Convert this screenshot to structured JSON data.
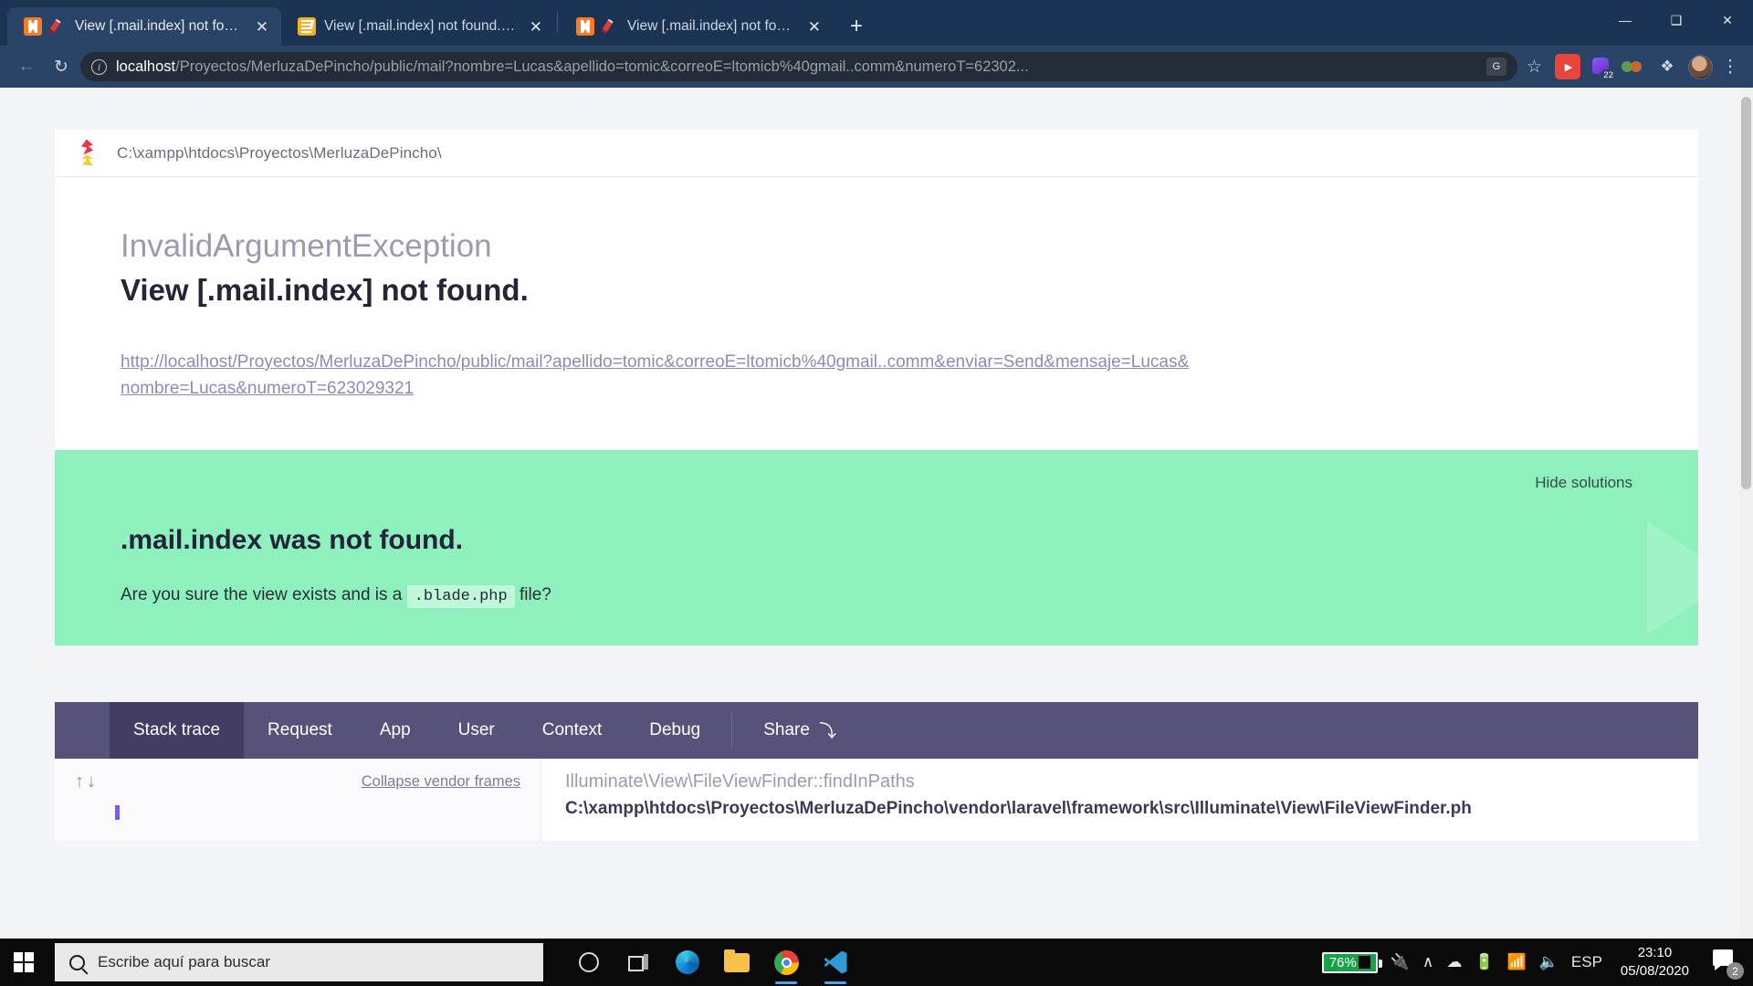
{
  "browser": {
    "tabs": [
      {
        "title": "View [.mail.index] not found.",
        "favicon": "xampp-icon",
        "secondary_icon": "pencil-icon",
        "active": true,
        "close_label": "✕"
      },
      {
        "title": "View [.mail.index] not found. - St",
        "favicon": "stackoverflow-icon",
        "secondary_icon": "",
        "active": false,
        "close_label": "✕"
      },
      {
        "title": "View [.mail.index] not found.",
        "favicon": "xampp-icon",
        "secondary_icon": "pencil-icon",
        "active": false,
        "close_label": "✕"
      }
    ],
    "new_tab_label": "+",
    "window_controls": {
      "minimize": "—",
      "maximize": "❑",
      "close": "✕"
    },
    "nav": {
      "back": "←",
      "forward": "→",
      "reload": "↻"
    },
    "address": {
      "info_icon_label": "i",
      "host": "localhost",
      "path": "/Proyectos/MerluzaDePincho/public/mail?nombre=Lucas&apellido=tomic&correoE=ltomicb%40gmail..comm&numeroT=62302...",
      "translate_icon_label": "G",
      "star_icon_label": "☆"
    },
    "extensions": [
      {
        "name": "idm-extension-icon",
        "badge": ""
      },
      {
        "name": "purple-extension-icon",
        "badge": "22"
      },
      {
        "name": "goggles-extension-icon",
        "badge": ""
      },
      {
        "name": "puzzle-extensions-icon",
        "badge": "❖"
      }
    ],
    "profile_label": "",
    "menu_label": "⋮"
  },
  "ignition": {
    "project_path": "C:\\xampp\\htdocs\\Proyectos\\MerluzaDePincho\\",
    "exception_class": "InvalidArgumentException",
    "exception_message": "View [.mail.index] not found.",
    "request_url": "http://localhost/Proyectos/MerluzaDePincho/public/mail?apellido=tomic&correoE=ltomicb%40gmail..comm&enviar=Send&mensaje=Lucas&nombre=Lucas&numeroT=623029321",
    "solutions": {
      "hide_label": "Hide solutions",
      "title": ".mail.index was not found.",
      "description_before": "Are you sure the view exists and is a",
      "code": ".blade.php",
      "description_after": "file?"
    },
    "tabs": [
      {
        "label": "Stack trace",
        "active": true
      },
      {
        "label": "Request",
        "active": false
      },
      {
        "label": "App",
        "active": false
      },
      {
        "label": "User",
        "active": false
      },
      {
        "label": "Context",
        "active": false
      },
      {
        "label": "Debug",
        "active": false
      }
    ],
    "share": {
      "label": "Share",
      "arrow": "⤵"
    },
    "stack": {
      "arrow_up": "↑",
      "arrow_down": "↓",
      "collapse_label": "Collapse vendor frames",
      "frame_function": "Illuminate\\View\\FileViewFinder::findInPaths",
      "frame_file": "C:\\xampp\\htdocs\\Proyectos\\MerluzaDePincho\\vendor\\laravel\\framework\\src\\Illuminate\\View\\FileViewFinder.ph"
    }
  },
  "taskbar": {
    "start_label": "Start",
    "search_placeholder": "Escribe aquí para buscar",
    "apps": [
      {
        "name": "cortana-icon"
      },
      {
        "name": "task-view-icon"
      },
      {
        "name": "edge-icon"
      },
      {
        "name": "file-explorer-icon"
      },
      {
        "name": "chrome-icon"
      },
      {
        "name": "vscode-icon"
      }
    ],
    "tray": {
      "battery_percent": "76%",
      "plug_icon": "⑂",
      "chevron_icon": "∧",
      "onedrive_icon": "☁",
      "battery_icon": "ὐB",
      "wifi_icon": "◠",
      "volume_icon": "ὐA",
      "language": "ESP",
      "time": "23:10",
      "date": "05/08/2020",
      "notification_count": "2"
    }
  },
  "colors": {
    "browser_chrome": "#1c3454",
    "omnibar": "#2a4468",
    "solutions_green": "#8ef0bd",
    "trace_tabs_purple": "#57527a",
    "trace_tab_active": "#433d63",
    "battery_green": "#18a04a"
  }
}
